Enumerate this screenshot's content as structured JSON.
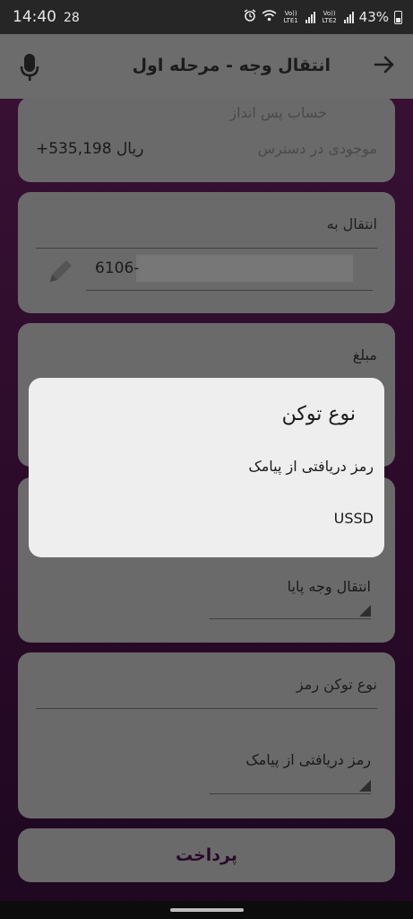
{
  "status_bar": {
    "time": "14:40",
    "extra": "28",
    "battery": "43%",
    "lte1": "Vo)) LTE1",
    "lte2": "Vo)) LTE2"
  },
  "app_bar": {
    "title": "انتقال وجه - مرحله اول"
  },
  "account_card": {
    "account_name": "حساب پس انداز",
    "balance_label": "موجودی در دسترس",
    "balance_value": "+535,198 ریال"
  },
  "transfer_to": {
    "label": "انتقال به",
    "value": "6106-"
  },
  "amount": {
    "label": "مبلغ"
  },
  "transfer_type": {
    "selected": "انتقال وجه پایا"
  },
  "token_card": {
    "label": "نوع توکن رمز",
    "selected": "رمز دریافتی از پیامک"
  },
  "pay_button": {
    "label": "پرداخت"
  },
  "dialog": {
    "title": "نوع توکن",
    "options": [
      "رمز دریافتی از پیامک",
      "USSD"
    ]
  },
  "colors": {
    "accent": "#3a1038",
    "dialog_bg": "#eeeeee"
  }
}
